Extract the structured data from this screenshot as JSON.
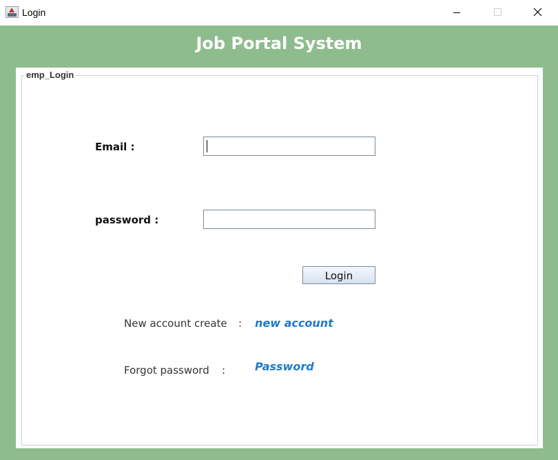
{
  "window": {
    "title": "Login",
    "app_icon": "java-app-icon",
    "controls": [
      "minimize-icon",
      "maximize-icon",
      "close-icon"
    ]
  },
  "header": {
    "title": "Job Portal System"
  },
  "panel": {
    "group_title": "emp_Login"
  },
  "form": {
    "email_label": "Email :",
    "email_value": "",
    "password_label": "password :",
    "password_value": "",
    "login_label": "Login"
  },
  "links": {
    "new_account_text": "New account create",
    "new_account_colon": ":",
    "new_account_link": "new account",
    "forgot_text": "Forgot password",
    "forgot_colon": ":",
    "forgot_link": "Password"
  },
  "colors": {
    "frame_green": "#8fbc8f",
    "link_blue": "#1f7ac9",
    "heading_text": "#ffffff"
  }
}
